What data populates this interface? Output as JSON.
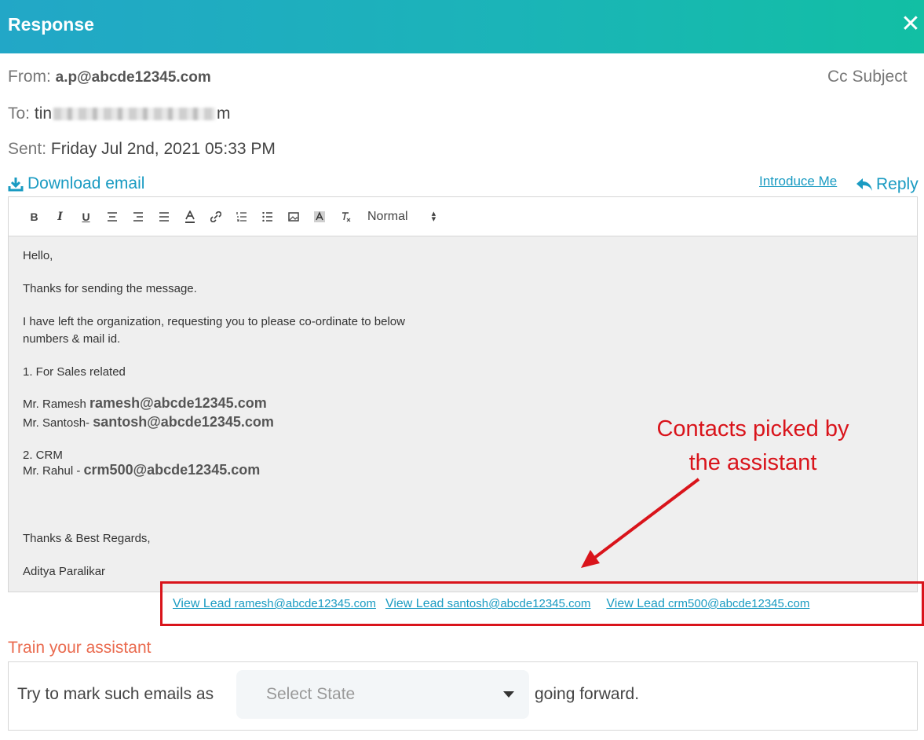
{
  "header": {
    "title": "Response",
    "close_glyph": "✕"
  },
  "meta": {
    "from_label": "From:",
    "from_value": "a.p@abcde12345.com",
    "to_label": "To:",
    "to_prefix": "tin",
    "to_suffix": "m",
    "sent_label": "Sent:",
    "sent_value": "Friday Jul 2nd, 2021 05:33 PM",
    "cc_label": "Cc",
    "subject_label": "Subject"
  },
  "actions": {
    "download_label": "Download email",
    "introduce_label": "Introduce Me",
    "reply_label": "Reply"
  },
  "toolbar": {
    "bold": "B",
    "italic": "I",
    "underline": "U",
    "format_value": "Normal"
  },
  "email_body": {
    "greeting": "Hello,",
    "line1": "Thanks for sending the message.",
    "line2a": "I have left the organization, requesting you to please co-ordinate to below",
    "line2b": "numbers & mail id.",
    "section1": "1. For Sales related",
    "contact1_name": "Mr. Ramesh",
    "contact1_email": "ramesh@abcde12345.com",
    "contact2_name": "Mr. Santosh-",
    "contact2_email": "santosh@abcde12345.com",
    "section2": "2. CRM",
    "contact3_name": "Mr. Rahul -",
    "contact3_email": "crm500@abcde12345.com",
    "closing": "Thanks & Best Regards,",
    "signature": "Aditya Paralikar"
  },
  "leads": [
    {
      "prefix": "View Lead",
      "email": "ramesh@abcde12345.com"
    },
    {
      "prefix": "View Lead",
      "email": "santosh@abcde12345.com"
    },
    {
      "prefix": "View Lead",
      "email": "crm500@abcde12345.com"
    }
  ],
  "annotation": {
    "line1": "Contacts picked by",
    "line2": "the assistant",
    "color": "#d9141b"
  },
  "train": {
    "title": "Train your assistant",
    "prefix": "Try to mark such emails as",
    "select_placeholder": "Select State",
    "suffix": "going forward."
  },
  "colors": {
    "accent": "#1a9bc2",
    "header_start": "#22a7c7",
    "header_end": "#12bfa4",
    "train_title": "#ea6a4e"
  }
}
